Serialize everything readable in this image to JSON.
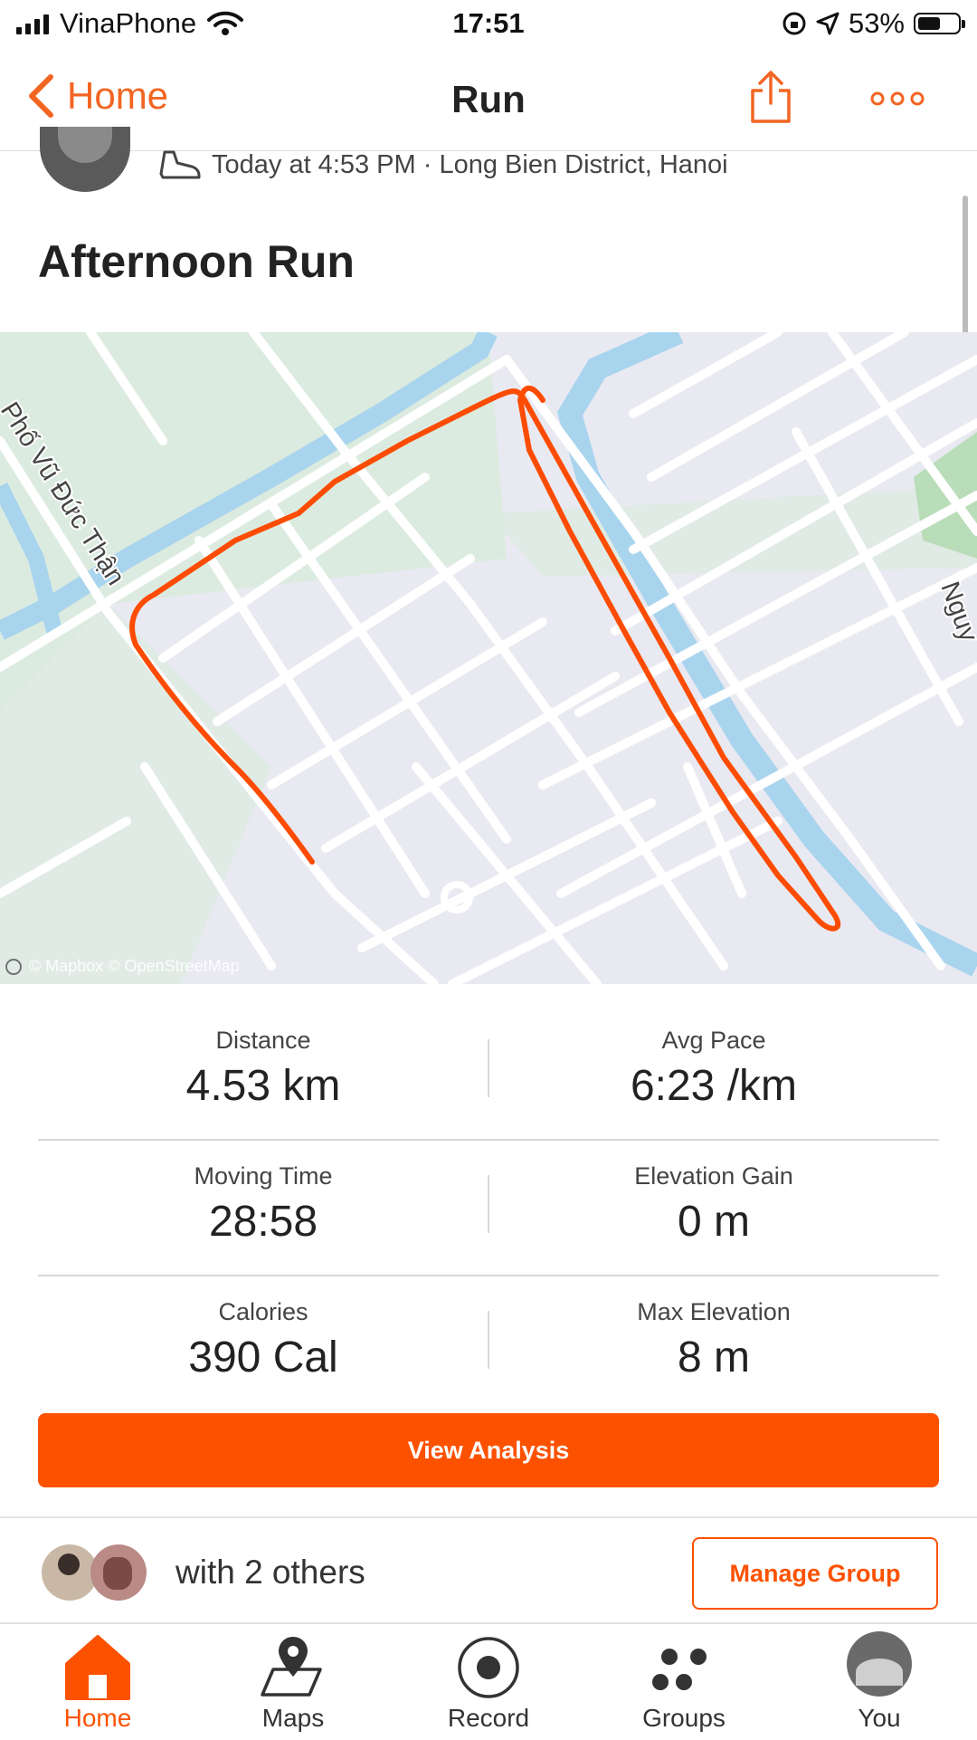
{
  "status_bar": {
    "carrier": "VinaPhone",
    "time": "17:51",
    "battery_percent": "53%"
  },
  "nav": {
    "back_label": "Home",
    "title": "Run"
  },
  "activity": {
    "meta": "Today at 4:53 PM · Long Bien District, Hanoi",
    "title": "Afternoon Run"
  },
  "map": {
    "street_labels": [
      "Phố Vũ Đức Thận",
      "Nguy"
    ],
    "attribution": "© Mapbox © OpenStreetMap",
    "route_color": "#fc4c02"
  },
  "stats": {
    "rows": [
      {
        "left": {
          "label": "Distance",
          "value": "4.53 km"
        },
        "right": {
          "label": "Avg Pace",
          "value": "6:23 /km"
        }
      },
      {
        "left": {
          "label": "Moving Time",
          "value": "28:58"
        },
        "right": {
          "label": "Elevation Gain",
          "value": "0 m"
        }
      },
      {
        "left": {
          "label": "Calories",
          "value": "390 Cal"
        },
        "right": {
          "label": "Max Elevation",
          "value": "8 m"
        }
      }
    ]
  },
  "actions": {
    "view_analysis": "View Analysis",
    "with_others": "with 2 others",
    "manage_group": "Manage Group"
  },
  "tabs": [
    {
      "label": "Home",
      "icon": "home-icon",
      "active": true
    },
    {
      "label": "Maps",
      "icon": "maps-icon",
      "active": false
    },
    {
      "label": "Record",
      "icon": "record-icon",
      "active": false
    },
    {
      "label": "Groups",
      "icon": "groups-icon",
      "active": false
    },
    {
      "label": "You",
      "icon": "avatar",
      "active": false
    }
  ],
  "colors": {
    "accent": "#fc5200",
    "water": "#a9d4ee",
    "park": "#dcebdf",
    "road": "#ffffff",
    "land": "#e9e9f2"
  }
}
